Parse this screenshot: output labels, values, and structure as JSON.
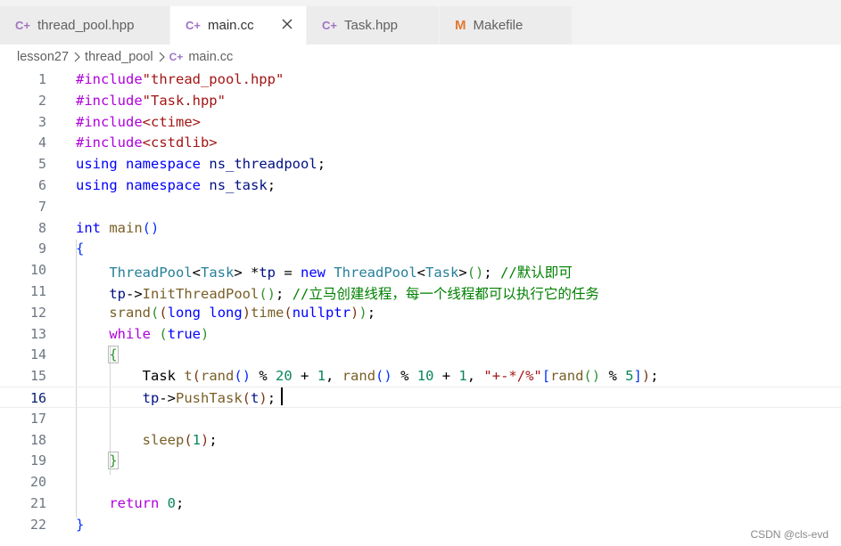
{
  "tabs": [
    {
      "label": "thread_pool.hpp",
      "icon": "cpp-file-icon",
      "active": false
    },
    {
      "label": "main.cc",
      "icon": "cpp-file-icon",
      "active": true
    },
    {
      "label": "Task.hpp",
      "icon": "cpp-file-icon",
      "active": false
    },
    {
      "label": "Makefile",
      "icon": "makefile-icon",
      "active": false
    }
  ],
  "tab_icon_glyph": "C+",
  "makefile_glyph": "M",
  "breadcrumb": [
    "lesson27",
    "thread_pool",
    "main.cc"
  ],
  "line_numbers": [
    "1",
    "2",
    "3",
    "4",
    "5",
    "6",
    "7",
    "8",
    "9",
    "10",
    "11",
    "12",
    "13",
    "14",
    "15",
    "16",
    "17",
    "18",
    "19",
    "20",
    "21",
    "22"
  ],
  "current_line": 16,
  "code_lines": [
    "#include\"thread_pool.hpp\"",
    "#include\"Task.hpp\"",
    "#include<ctime>",
    "#include<cstdlib>",
    "using namespace ns_threadpool;",
    "using namespace ns_task;",
    "",
    "int main()",
    "{",
    "    ThreadPool<Task> *tp = new ThreadPool<Task>(); //默认即可",
    "    tp->InitThreadPool(); //立马创建线程，每一个线程都可以执行它的任务",
    "    srand((long long)time(nullptr));",
    "    while (true)",
    "    {",
    "        Task t(rand() % 20 + 1, rand() % 10 + 1, \"+-*/%\"[rand() % 5]);",
    "        tp->PushTask(t);",
    "",
    "        sleep(1);",
    "    }",
    "",
    "    return 0;",
    "}"
  ],
  "watermark": "CSDN @cls-evd",
  "colors": {
    "tab_bar_bg": "#f3f3f3",
    "inactive_tab_bg": "#ececec",
    "active_tab_bg": "#ffffff",
    "cpp_icon": "#a074c4",
    "makefile_icon": "#e37933",
    "keyword": "#0000ff",
    "control": "#af00db",
    "type": "#267f99",
    "function": "#795e26",
    "variable": "#001080",
    "string": "#a31515",
    "number": "#098658",
    "comment": "#008000"
  }
}
